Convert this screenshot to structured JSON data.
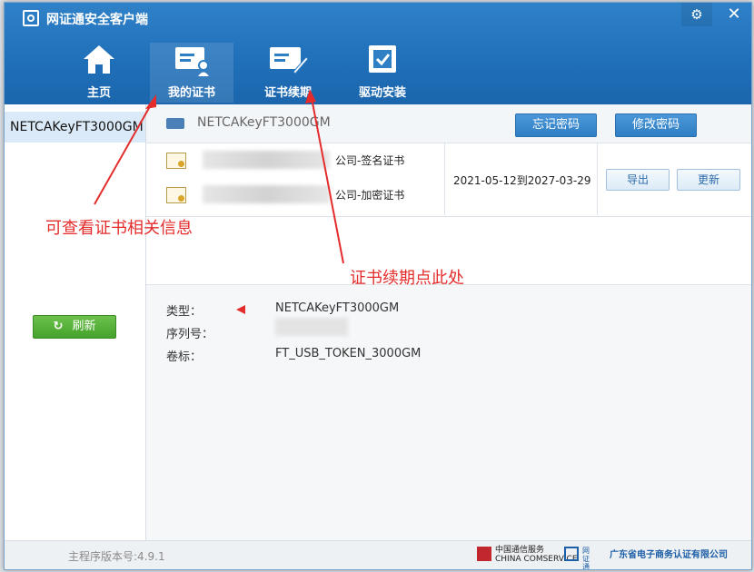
{
  "window": {
    "title": "网证通安全客户端",
    "icons": {
      "settings": "gear-icon",
      "close": "close-icon"
    },
    "close_glyph": "✕",
    "settings_glyph": "⚙"
  },
  "nav": [
    {
      "label": "主页",
      "icon": "home-icon"
    },
    {
      "label": "我的证书",
      "icon": "certificate-icon",
      "active": true
    },
    {
      "label": "证书续期",
      "icon": "certificate-renew-icon"
    },
    {
      "label": "驱动安装",
      "icon": "driver-install-icon"
    }
  ],
  "sidebar": {
    "device": "NETCAKeyFT3000GM",
    "refresh_label": "刷新"
  },
  "device_bar": {
    "device_name": "NETCAKeyFT3000GM",
    "forgot_password": "忘记密码",
    "change_password": "修改密码"
  },
  "certificates": {
    "rows": [
      {
        "name": "公司-签名证书"
      },
      {
        "name": "公司-加密证书"
      }
    ],
    "validity": "2021-05-12到2027-03-29",
    "export_label": "导出",
    "renew_label": "更新"
  },
  "details": {
    "type_label": "类型：",
    "type_value": "NETCAKeyFT3000GM",
    "serial_label": "序列号：",
    "volume_label": "卷标：",
    "volume_value": "FT_USB_TOKEN_3000GM"
  },
  "footer": {
    "version": "主程序版本号:4.9.1",
    "logo_ct": "中国通信服务\nCHINA COMSERVICE",
    "logo_netca": "网证通",
    "logo_gd": "广东省电子商务认证有限公司"
  },
  "annotations": {
    "cert_info": "可查看证书相关信息",
    "renew_here": "证书续期点此处"
  },
  "colors": {
    "header": "#1f6fb8",
    "accent": "#2f7fc4",
    "annotation": "#e42c2c",
    "refresh": "#44a22b"
  }
}
